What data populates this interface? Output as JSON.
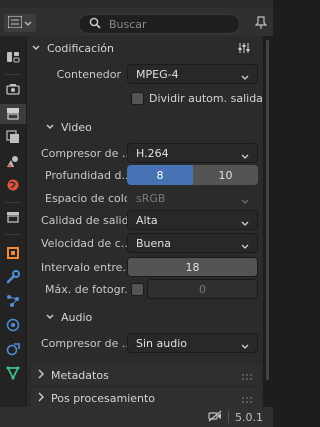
{
  "header": {
    "search_placeholder": "Buscar"
  },
  "tabs": [
    {
      "name": "tool-icon",
      "color": "#bfbfbf"
    },
    {
      "name": "render-icon",
      "color": "#bfbfbf"
    },
    {
      "name": "output-icon",
      "color": "#bfbfbf"
    },
    {
      "name": "view-layer-icon",
      "color": "#bfbfbf"
    },
    {
      "name": "scene-icon",
      "color": "#bfbfbf"
    },
    {
      "name": "world-icon",
      "color": "#e0533e"
    },
    {
      "name": "collection-icon",
      "color": "#bfbfbf"
    },
    {
      "name": "object-icon",
      "color": "#f0893a"
    },
    {
      "name": "modifier-icon",
      "color": "#4d8fd6"
    },
    {
      "name": "particles-icon",
      "color": "#4d8fd6"
    },
    {
      "name": "physics-icon",
      "color": "#4d8fd6"
    },
    {
      "name": "constraint-icon",
      "color": "#4d8fd6"
    },
    {
      "name": "data-icon",
      "color": "#3fc28b"
    }
  ],
  "encoding": {
    "title": "Codificación",
    "container_label": "Contenedor",
    "container_value": "MPEG-4",
    "autosplit_label": "Dividir autom. salida"
  },
  "video": {
    "title": "Video",
    "codec_label": "Compresor de ...",
    "codec_value": "H.264",
    "depth_label": "Profundidad d...",
    "depth_option_a": "8",
    "depth_option_b": "10",
    "color_space_label": "Espacio de color",
    "color_space_value": "sRGB",
    "quality_label": "Calidad de salida",
    "quality_value": "Alta",
    "speed_label": "Velocidad de c...",
    "speed_value": "Buena",
    "keyframe_label": "Intervalo entre...",
    "keyframe_value": "18",
    "max_bframes_label": "Máx. de fotogr...",
    "max_bframes_value": "0"
  },
  "audio": {
    "title": "Audio",
    "codec_label": "Compresor de ...",
    "codec_value": "Sin audio"
  },
  "collapsed": {
    "metadata": "Metadatos",
    "post_processing": "Pos procesamiento"
  },
  "status": {
    "version": "5.0.1"
  }
}
